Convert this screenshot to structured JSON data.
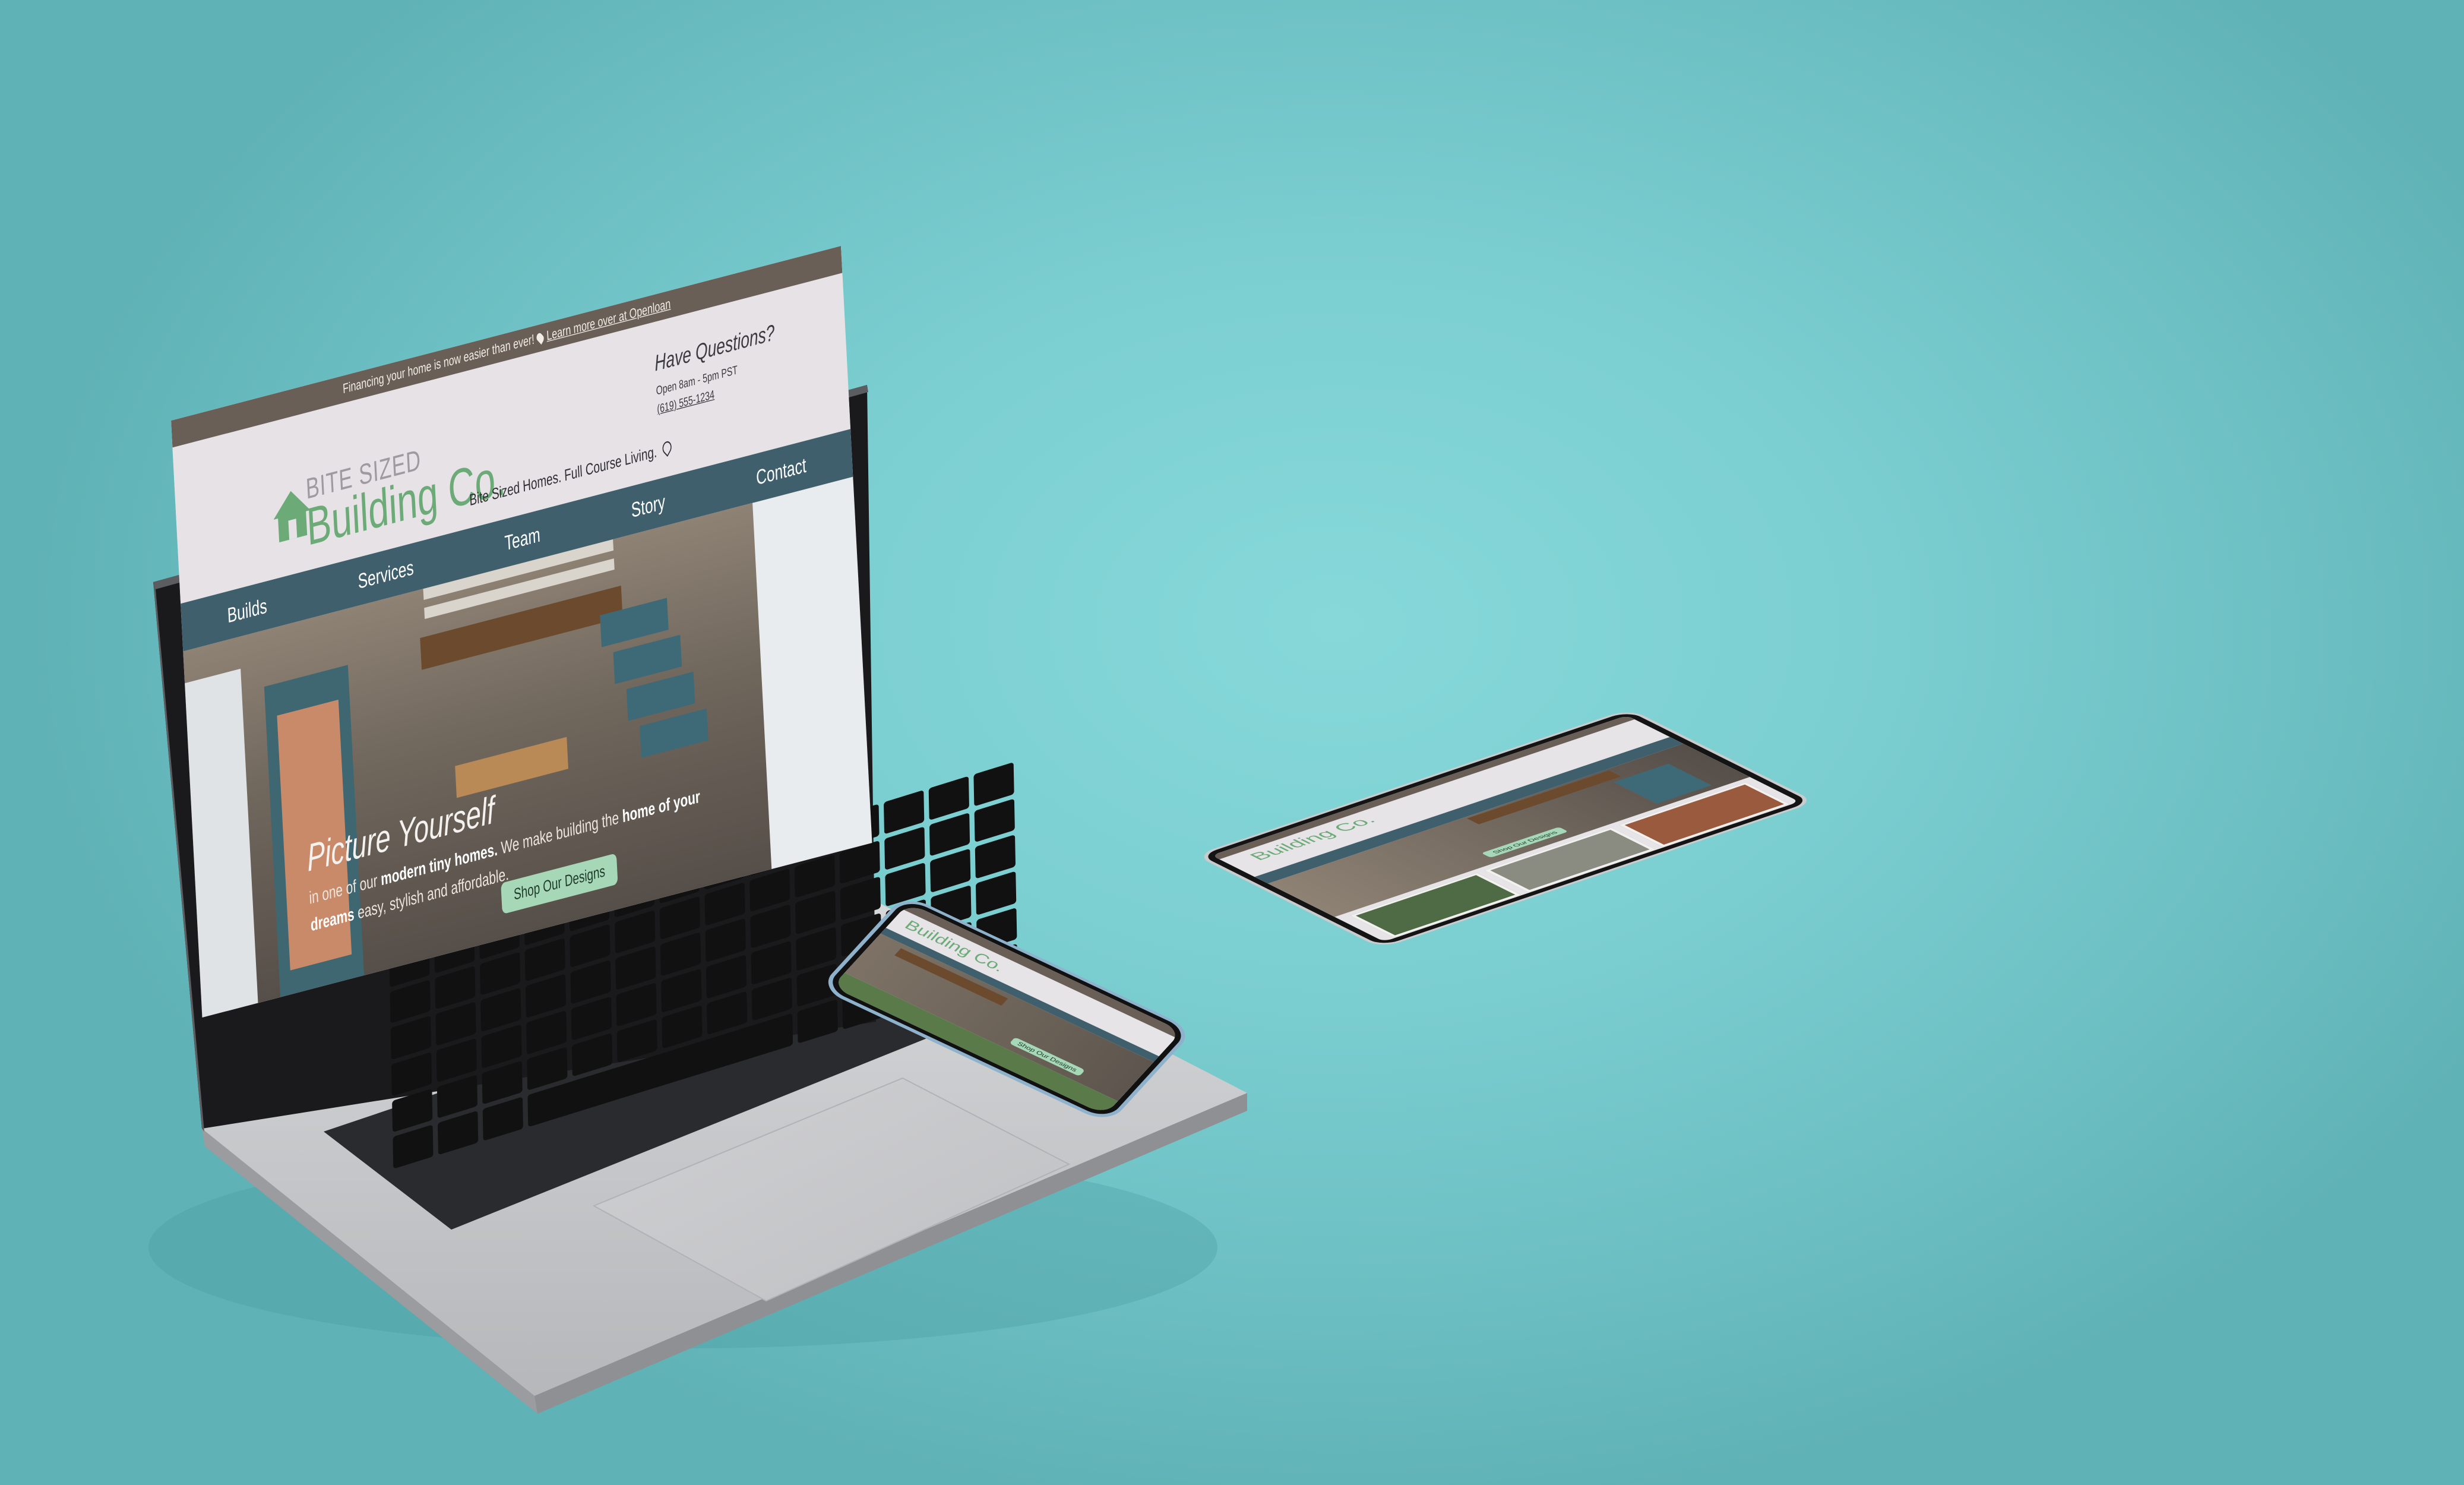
{
  "site": {
    "announcement": "Financing your home is now easier than ever!",
    "announcement_link": "Learn more over at Openloan",
    "logo_small": "BITE SIZED",
    "logo_big": "Building Co.",
    "tagline": "Bite Sized Homes. Full Course Living.",
    "questions_title": "Have Questions?",
    "hours": "Open 8am - 5pm PST",
    "phone": "(619) 555-1234",
    "nav": [
      "Builds",
      "Services",
      "Team",
      "Story",
      "Contact"
    ],
    "hero_title": "Picture Yourself",
    "hero_text_1": "in one of our",
    "hero_text_bold_1": "modern tiny homes.",
    "hero_text_2": "We make building the",
    "hero_text_bold_2": "home of your dreams",
    "hero_text_3": "easy, stylish and affordable.",
    "cta": "Shop Our Designs"
  },
  "colors": {
    "background": "#7ccfd1",
    "nav": "#3f5f6d",
    "logo_green": "#6cab78",
    "cta": "#a6d7b7",
    "announcement_bar": "#6a5f57"
  },
  "icons": [
    "house-logo-icon",
    "location-pin-icon",
    "heart-icon"
  ]
}
